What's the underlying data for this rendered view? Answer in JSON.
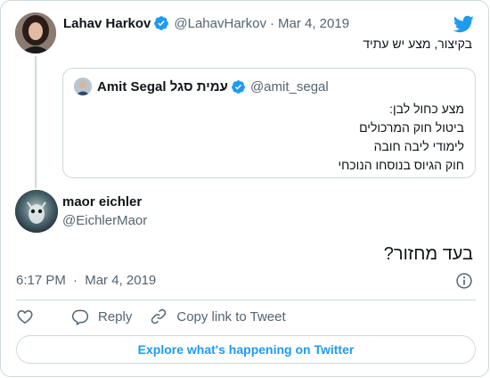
{
  "parent_tweet": {
    "author_name": "Lahav Harkov",
    "handle": "@LahavHarkov",
    "separator": "·",
    "date": "Mar 4, 2019",
    "text": "בקיצור, מצע יש עתיד"
  },
  "quoted_tweet": {
    "author_name": "Amit Segal עמית סגל",
    "handle": "@amit_segal",
    "lines": [
      "מצע כחול לבן:",
      "ביטול חוק המרכולים",
      "לימודי ליבה חובה",
      "חוק הגיוס בנוסחו הנוכחי"
    ]
  },
  "main_tweet": {
    "author_name": "maor eichler",
    "handle": "@EichlerMaor",
    "text": "בעד מחזור?",
    "time": "6:17 PM",
    "separator": "·",
    "date": "Mar 4, 2019"
  },
  "actions": {
    "like_icon": "heart-icon",
    "reply_label": "Reply",
    "copy_link_label": "Copy link to Tweet"
  },
  "explore_label": "Explore what's happening on Twitter",
  "colors": {
    "accent": "#1d9bf0",
    "text": "#0f1419",
    "muted": "#536471",
    "border": "#cfd9de"
  }
}
